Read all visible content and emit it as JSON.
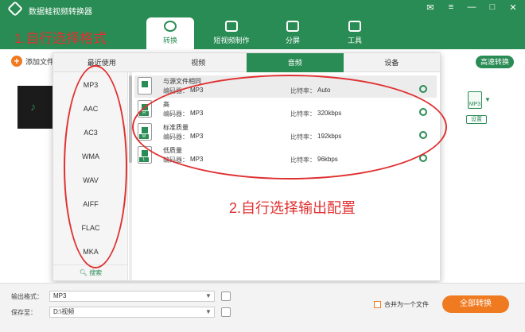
{
  "app": {
    "title": "数据蛙视频转换器",
    "window_controls": [
      "✉",
      "≡",
      "—",
      "□",
      "✕"
    ]
  },
  "nav": {
    "tabs": [
      {
        "label": "转换",
        "icon": "convert-icon",
        "active": true
      },
      {
        "label": "短视频制作",
        "icon": "tv-icon",
        "active": false
      },
      {
        "label": "分屏",
        "icon": "split-screen-icon",
        "active": false
      },
      {
        "label": "工具",
        "icon": "toolbox-icon",
        "active": false
      }
    ]
  },
  "toolbar": {
    "add_file_label": "添加文件",
    "fast_convert_label": "高速转换"
  },
  "file_item": {
    "format_badge": "MP3",
    "settings_label": "设置"
  },
  "popup": {
    "tabs": [
      "最近使用",
      "视频",
      "音频",
      "设备"
    ],
    "active_tab": "音频",
    "formats": [
      "MP3",
      "AAC",
      "AC3",
      "WMA",
      "WAV",
      "AIFF",
      "FLAC",
      "MKA"
    ],
    "search_label": "搜索",
    "presets": [
      {
        "name": "与源文件相同",
        "encoder_label": "编码器：",
        "encoder": "MP3",
        "bitrate_label": "比特率：",
        "bitrate": "Auto",
        "badge": "",
        "selected": true
      },
      {
        "name": "高",
        "encoder_label": "编码器：",
        "encoder": "MP3",
        "bitrate_label": "比特率：",
        "bitrate": "320kbps",
        "badge": "H",
        "selected": false
      },
      {
        "name": "标准质量",
        "encoder_label": "编码器：",
        "encoder": "MP3",
        "bitrate_label": "比特率：",
        "bitrate": "192kbps",
        "badge": "M",
        "selected": false
      },
      {
        "name": "低质量",
        "encoder_label": "编码器：",
        "encoder": "MP3",
        "bitrate_label": "比特率：",
        "bitrate": "96kbps",
        "badge": "L",
        "selected": false
      }
    ]
  },
  "annotations": {
    "step1": "1.自行选择格式",
    "step2": "2.自行选择输出配置"
  },
  "bottom": {
    "output_format_label": "输出格式：",
    "output_format_value": "MP3",
    "save_to_label": "保存至：",
    "save_to_value": "D:\\视频",
    "merge_label": "合并为一个文件",
    "convert_all_label": "全部转换"
  },
  "colors": {
    "brand_green": "#2a8c55",
    "accent_orange": "#f07a1f",
    "annotation_red": "#e03030"
  }
}
